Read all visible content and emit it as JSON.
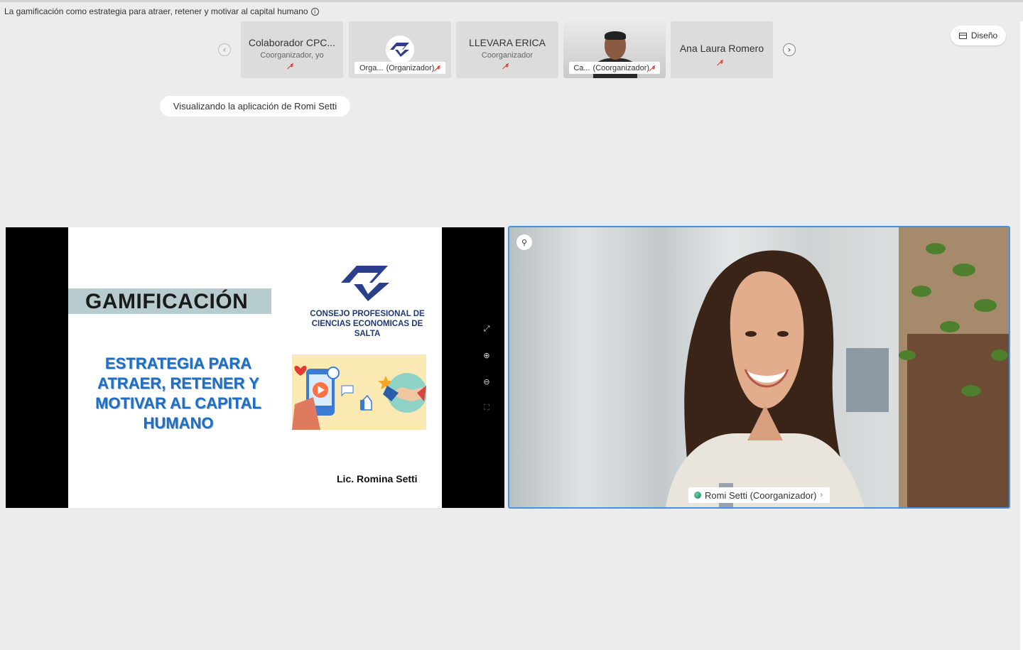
{
  "meeting": {
    "title": "La gamificación como estrategia para atraer, retener y motivar al capital humano",
    "info_icon": "info-icon"
  },
  "participants_strip": {
    "prev_icon": "chevron-left-icon",
    "next_icon": "chevron-right-icon",
    "tiles": [
      {
        "name": "Colaborador CPC...",
        "role": "Coorganizador, yo",
        "muted": true
      },
      {
        "label": "Orga...",
        "role_label": "(Organizador)",
        "muted": true,
        "avatar": "cpce-logo"
      },
      {
        "name": "LLEVARA ERICA",
        "role": "Coorganizador",
        "muted": true
      },
      {
        "label": "Ca...",
        "role_label": "(Coorganizador)",
        "muted": true,
        "video": true
      },
      {
        "name": "Ana Laura Romero",
        "muted": true
      }
    ]
  },
  "layout_button": {
    "label": "Diseño",
    "icon": "layout-icon"
  },
  "sharing_indicator": {
    "text": "Visualizando la aplicación de Romi Setti"
  },
  "shared_slide": {
    "title": "GAMIFICACIÓN",
    "subtitle": "ESTRATEGIA PARA ATRAER, RETENER Y MOTIVAR AL CAPITAL HUMANO",
    "org_name": "CONSEJO PROFESIONAL DE CIENCIAS ECONOMICAS DE SALTA",
    "author": "Lic. Romina Setti"
  },
  "share_controls": [
    "expand-icon",
    "zoom-in-icon",
    "zoom-out-icon",
    "fit-icon"
  ],
  "active_video": {
    "label": "Romi Setti (Coorganizador)",
    "pin_icon": "pin-icon"
  },
  "colors": {
    "accent": "#4a90e2",
    "muted_icon": "#d9251d",
    "slide_blue": "#1c6fc7",
    "background": "#ececec"
  }
}
